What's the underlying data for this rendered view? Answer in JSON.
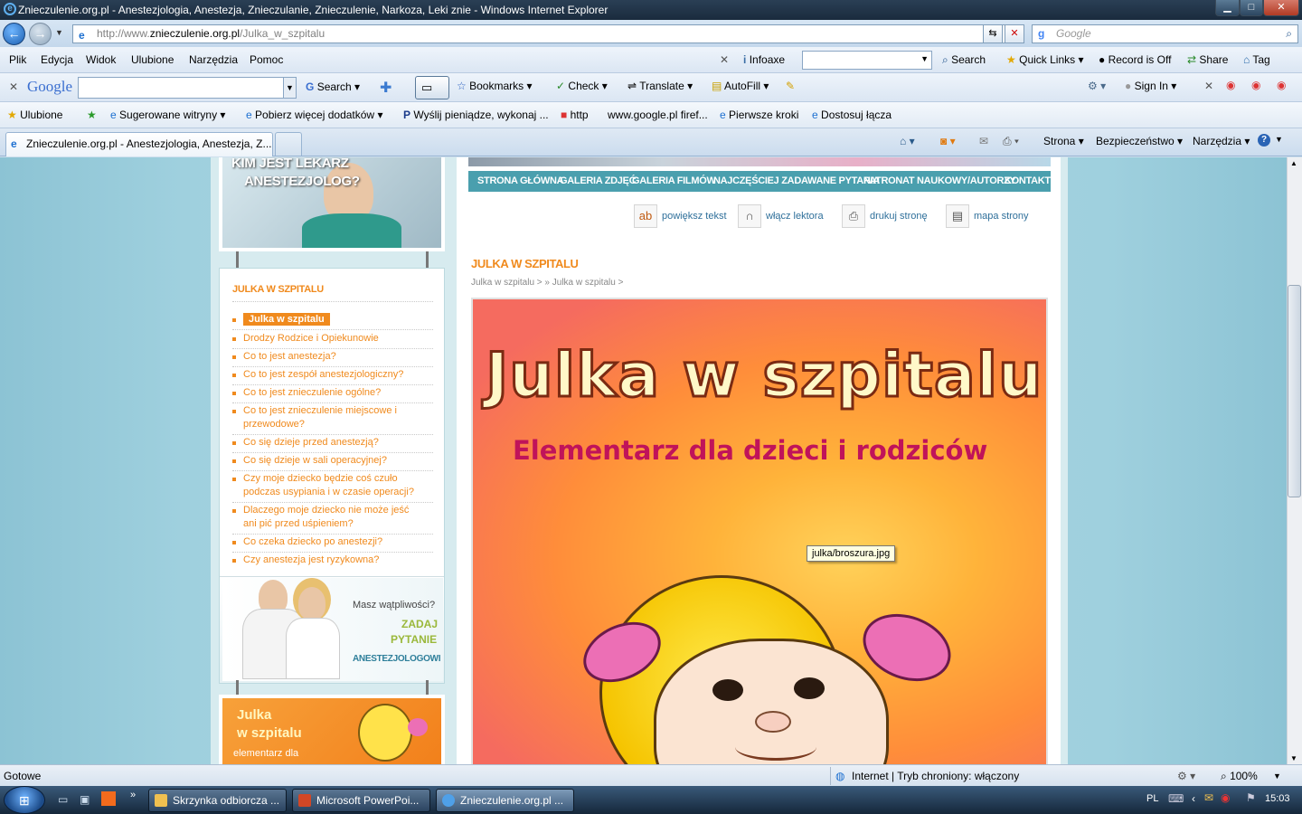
{
  "window": {
    "title": "Znieczulenie.org.pl - Anestezjologia, Anestezja, Znieczulanie, Znieczulenie, Narkoza, Leki znie - Windows Internet Explorer",
    "min": "▁",
    "max": "□",
    "close": "✕"
  },
  "address": {
    "url_prefix": "http://www.",
    "url_domain": "znieczulenie.org.pl",
    "url_path": "/Julka_w_szpitalu",
    "search_placeholder": "Google"
  },
  "menu": [
    "Plik",
    "Edycja",
    "Widok",
    "Ulubione",
    "Narzędzia",
    "Pomoc"
  ],
  "menu_right": {
    "infoaxe": "Infoaxe",
    "search": "Search",
    "quick_links": "Quick Links",
    "record": "Record is Off",
    "share": "Share",
    "tag": "Tag"
  },
  "google_toolbar": {
    "brand": "Google",
    "search": "Search",
    "bookmarks": "Bookmarks",
    "check": "Check",
    "translate": "Translate",
    "autofill": "AutoFill",
    "sign_in": "Sign In"
  },
  "favorites": {
    "ulubione": "Ulubione",
    "items": [
      "Sugerowane witryny",
      "Pobierz więcej dodatków",
      "Wyślij pieniądze, wykonaj ...",
      "http",
      "www.google.pl firef...",
      "Pierwsze kroki",
      "Dostosuj łącza"
    ]
  },
  "tab": {
    "title": "Znieczulenie.org.pl - Anestezjologia, Anestezja, Z...",
    "cmd_strona": "Strona",
    "cmd_bezpieczenstwo": "Bezpieczeństwo",
    "cmd_narzedzia": "Narzędzia"
  },
  "site": {
    "promo_top": {
      "line1": "KIM JEST LEKARZ",
      "line2": "ANESTEZJOLOG?"
    },
    "nav": [
      "STRONA GŁÓWNA",
      "GALERIA ZDJĘĆ",
      "GALERIA FILMÓW",
      "NAJCZĘŚCIEJ ZADAWANE PYTANIA",
      "PATRONAT NAUKOWY/AUTORZY",
      "KONTAKT"
    ],
    "tools": [
      "powiększ tekst",
      "włącz lektora",
      "drukuj stronę",
      "mapa strony"
    ],
    "side_heading": "JULKA W SZPITALU",
    "side_items": [
      "Julka w szpitalu",
      "Drodzy Rodzice i Opiekunowie",
      "Co to jest anestezja?",
      "Co to jest zespół anestezjologiczny?",
      "Co to jest znieczulenie ogólne?",
      "Co to jest znieczulenie miejscowe i przewodowe?",
      "Co się dzieje przed anestezją?",
      "Co się dzieje w sali operacyjnej?",
      "Czy moje dziecko będzie coś czuło podczas usypiania i w czasie operacji?",
      "Dlaczego moje dziecko nie może jeść ani pić przed uśpieniem?",
      "Co czeka dziecko po anestezji?",
      "Czy anestezja jest ryzykowna?"
    ],
    "ask": {
      "q": "Masz wątpliwości?",
      "l1": "ZADAJ",
      "l2": "PYTANIE",
      "l3": "ANESTEZJOLOGOWI"
    },
    "promo_julka": {
      "l1": "Julka",
      "l2": "w szpitalu",
      "l3": "elementarz dla"
    },
    "page_title": "JULKA W SZPITALU",
    "breadcrumb": "Julka w szpitalu >  »  Julka w szpitalu  >",
    "hero_title": "Julka w szpitalu",
    "hero_subtitle": "Elementarz dla dzieci i rodziców",
    "tooltip": "julka/broszura.jpg"
  },
  "status": {
    "left": "Gotowe",
    "zone": "Internet | Tryb chroniony: włączony",
    "zoom": "100%"
  },
  "taskbar": {
    "buttons": [
      "Skrzynka odbiorcza ...",
      "Microsoft PowerPoi...",
      "Znieczulenie.org.pl ..."
    ],
    "lang": "PL",
    "time": "15:03"
  },
  "colors": {
    "accent_orange": "#f08a1d",
    "nav_teal": "#4a9fae",
    "link_blue": "#2e6f9a"
  }
}
